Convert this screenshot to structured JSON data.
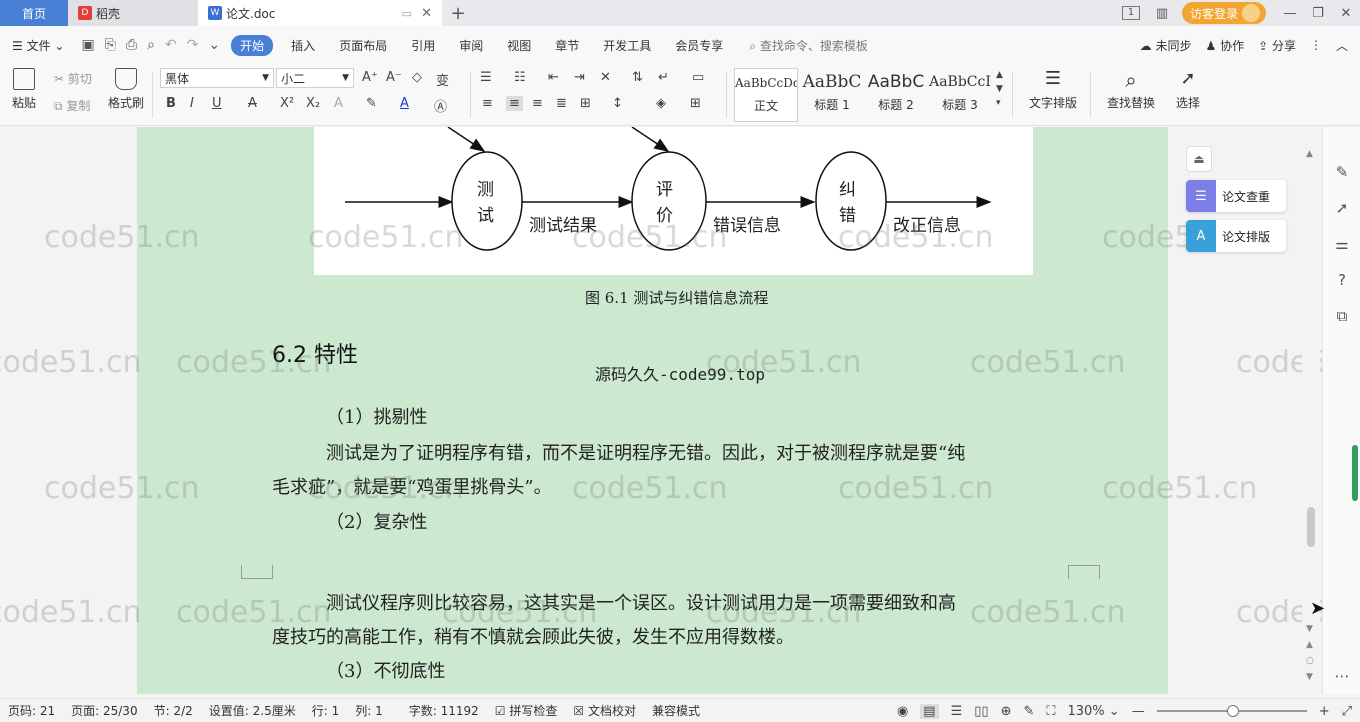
{
  "tabs": {
    "home": "首页",
    "t1": "稻壳",
    "t2": "论文.doc",
    "visitor_login": "访客登录",
    "page_indicator": "1"
  },
  "menu": {
    "file": "文件",
    "items": [
      "开始",
      "插入",
      "页面布局",
      "引用",
      "审阅",
      "视图",
      "章节",
      "开发工具",
      "会员专享"
    ],
    "search_placeholder": "查找命令、搜索模板",
    "unsynced": "未同步",
    "collab": "协作",
    "share": "分享"
  },
  "ribbon": {
    "paste": "粘贴",
    "cut": "剪切",
    "copy": "复制",
    "format_painter": "格式刷",
    "font_name": "黑体",
    "font_size": "小二",
    "styles": [
      {
        "sample": "AaBbCcDd",
        "label": "正文"
      },
      {
        "sample": "AaBbC",
        "label": "标题 1"
      },
      {
        "sample": "AaBbC",
        "label": "标题 2"
      },
      {
        "sample": "AaBbCcI",
        "label": "标题 3"
      }
    ],
    "text_layout": "文字排版",
    "find_replace": "查找替换",
    "select": "选择"
  },
  "figure": {
    "nodes": [
      "测\n试",
      "评\n价",
      "纠\n错"
    ],
    "labels": [
      "测试结果",
      "错误信息",
      "改正信息"
    ],
    "caption": "图 6.1 测试与纠错信息流程"
  },
  "document": {
    "heading": "6.2 特性",
    "watermark_line": "源码久久-code99.top",
    "p1_title": "（1）挑剔性",
    "p1_line1": "测试是为了证明程序有错，而不是证明程序无错。因此，对于被测程序就是要“纯",
    "p1_line2": "毛求疵”，就是要“鸡蛋里挑骨头”。",
    "p2_title": "（2）复杂性",
    "p2_line1": "测试仪程序则比较容易，这其实是一个误区。设计测试用力是一项需要细致和高",
    "p2_line2": "度技巧的高能工作，稍有不慎就会顾此失彼，发生不应用得数楼。",
    "p3_title": "（3）不彻底性"
  },
  "watermark": "code51.cn",
  "side_panel": {
    "check": "论文查重",
    "layout": "论文排版"
  },
  "status": {
    "page_num": "页码: 21",
    "pages": "页面: 25/30",
    "section": "节: 2/2",
    "setting": "设置值: 2.5厘米",
    "row": "行: 1",
    "col": "列: 1",
    "words": "字数: 11192",
    "spell": "拼写检查",
    "proof": "文档校对",
    "compat": "兼容模式",
    "zoom": "130%"
  },
  "colors": {
    "accent": "#4a7fd6",
    "page_bg": "#cce8cf",
    "visitor": "#f2a530"
  }
}
